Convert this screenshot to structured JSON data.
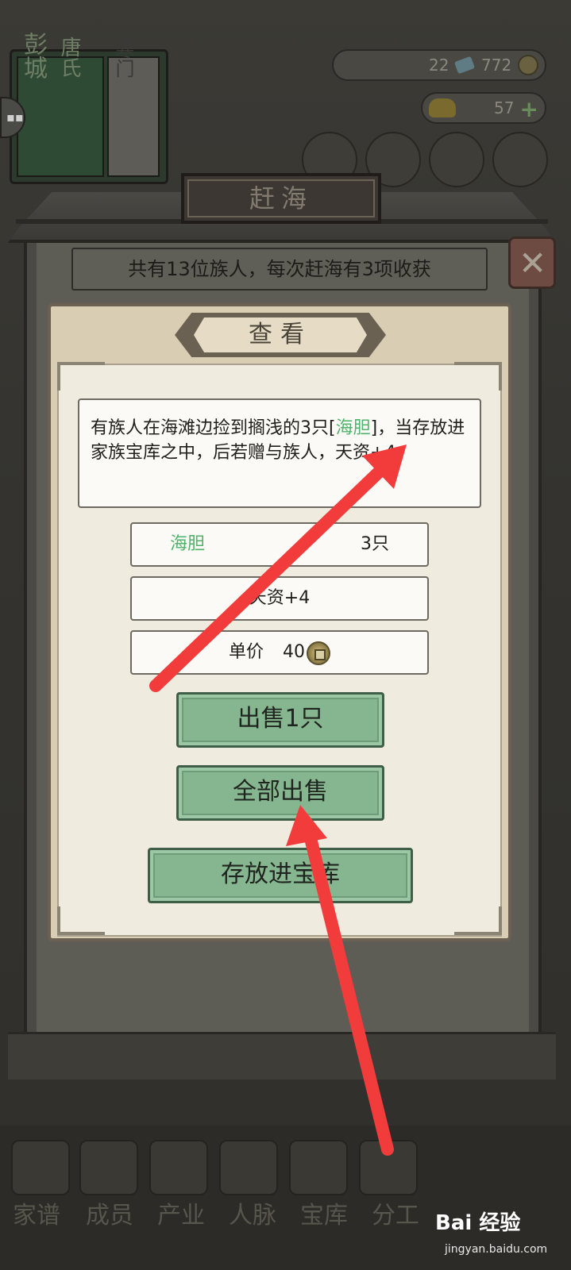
{
  "background": {
    "family_book": {
      "title_left": "彭城",
      "title_mid": "唐氏",
      "title_right": "寒门"
    },
    "chat_icon": "chat-bubble-icon",
    "currency": {
      "ticket_count": "22",
      "coin_count": "772",
      "gold_count": "57"
    },
    "bottom_nav": [
      "家谱",
      "成员",
      "产业",
      "人脉",
      "宝库",
      "分工"
    ]
  },
  "modal": {
    "title": "赶海",
    "info": "共有13位族人，每次赶海有3项收获",
    "close_icon": "close-x-icon"
  },
  "dialog": {
    "title": "查看",
    "description_pre": "有族人在海滩边捡到搁浅的3只[",
    "description_item": "海胆",
    "description_post": "]，当存放进家族宝库之中，后若赠与族人，天资+4。",
    "item_name": "海胆",
    "item_count": "3只",
    "effect": "天资+4",
    "price_label": "单价",
    "price_value": "40",
    "buttons": {
      "sell_one": "出售1只",
      "sell_all": "全部出售",
      "store": "存放进宝库"
    }
  },
  "watermark": {
    "brand": "Bai 经验",
    "url": "jingyan.baidu.com"
  },
  "colors": {
    "accent_green": "#4fb36a",
    "button_green": "#86b690",
    "arrow_red": "#f23b3b"
  }
}
